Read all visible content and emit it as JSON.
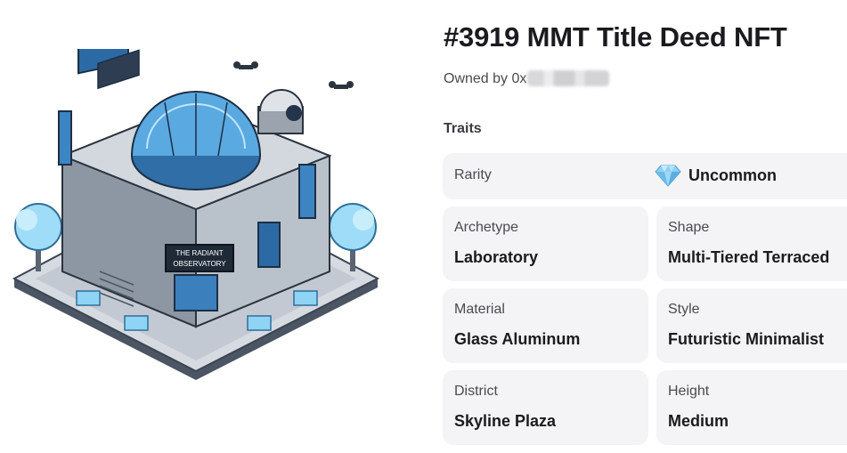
{
  "nft": {
    "title": "#3919 MMT Title Deed NFT",
    "owner_prefix": "Owned by 0x",
    "image_label_line1": "THE RADIANT",
    "image_label_line2": "OBSERVATORY"
  },
  "traits": {
    "heading": "Traits",
    "rarity": {
      "label": "Rarity",
      "value": "Uncommon",
      "icon": "diamond-icon"
    },
    "items": [
      {
        "label": "Archetype",
        "value": "Laboratory"
      },
      {
        "label": "Shape",
        "value": "Multi-Tiered Terraced"
      },
      {
        "label": "Material",
        "value": "Glass Aluminum"
      },
      {
        "label": "Style",
        "value": "Futuristic Minimalist"
      },
      {
        "label": "District",
        "value": "Skyline Plaza"
      },
      {
        "label": "Height",
        "value": "Medium"
      }
    ]
  },
  "colors": {
    "card_bg": "#f4f4f6",
    "text": "#1b1b1f",
    "accent_glass": "#4fa6e0"
  }
}
